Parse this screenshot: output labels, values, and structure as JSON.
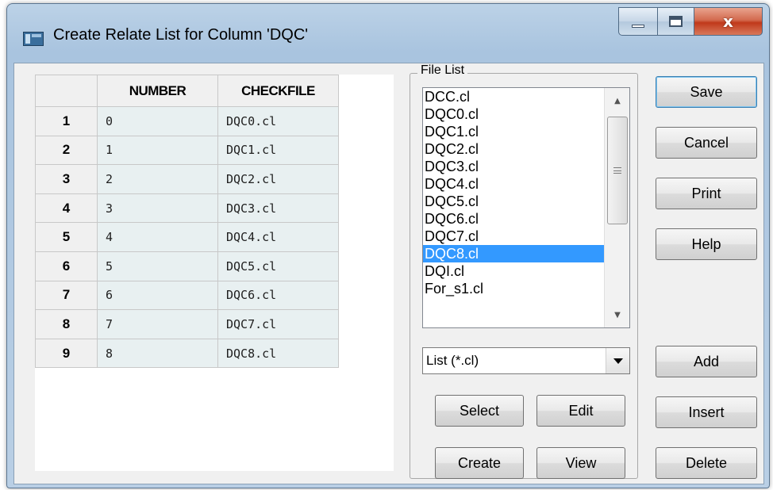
{
  "window": {
    "title": "Create Relate List for Column 'DQC'",
    "close_glyph": "x"
  },
  "grid": {
    "headers": [
      "NUMBER",
      "CHECKFILE"
    ],
    "rows": [
      {
        "index": "1",
        "number": "0",
        "checkfile": "DQC0.cl"
      },
      {
        "index": "2",
        "number": "1",
        "checkfile": "DQC1.cl"
      },
      {
        "index": "3",
        "number": "2",
        "checkfile": "DQC2.cl"
      },
      {
        "index": "4",
        "number": "3",
        "checkfile": "DQC3.cl"
      },
      {
        "index": "5",
        "number": "4",
        "checkfile": "DQC4.cl"
      },
      {
        "index": "6",
        "number": "5",
        "checkfile": "DQC5.cl"
      },
      {
        "index": "7",
        "number": "6",
        "checkfile": "DQC6.cl"
      },
      {
        "index": "8",
        "number": "7",
        "checkfile": "DQC7.cl"
      },
      {
        "index": "9",
        "number": "8",
        "checkfile": "DQC8.cl"
      }
    ]
  },
  "file_list": {
    "label": "File List",
    "items": [
      "DCC.cl",
      "DQC0.cl",
      "DQC1.cl",
      "DQC2.cl",
      "DQC3.cl",
      "DQC4.cl",
      "DQC5.cl",
      "DQC6.cl",
      "DQC7.cl",
      "DQC8.cl",
      "DQI.cl",
      "For_s1.cl"
    ],
    "selected": "DQC8.cl",
    "filter": "List (*.cl)"
  },
  "buttons": {
    "select": "Select",
    "edit": "Edit",
    "create": "Create",
    "view": "View",
    "save": "Save",
    "cancel": "Cancel",
    "print": "Print",
    "help": "Help",
    "add": "Add",
    "insert": "Insert",
    "delete": "Delete"
  }
}
